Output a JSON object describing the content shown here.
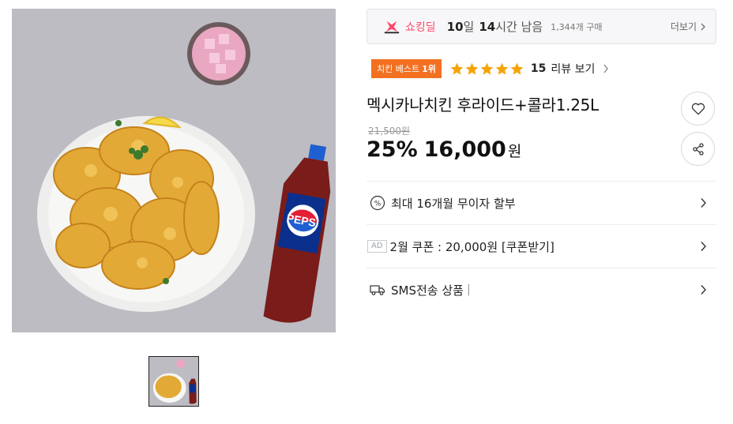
{
  "colors": {
    "deal_pink": "#ff4a6b",
    "rank_orange": "#f37021",
    "star_gold": "#f5a50a",
    "price_black": "#111111",
    "image_bg": "#bdbcc3"
  },
  "gallery": {
    "main_image_alt": "",
    "thumbnail_count": 1,
    "pepsi_label": "PEPSI"
  },
  "deal_bar": {
    "icon": "shopping-deal-icon",
    "name": "쇼킹딜",
    "days_num": "10",
    "days_unit": "일",
    "hours_num": "14",
    "hours_unit": "시간 남음",
    "purchase_count": "1,344개 구매",
    "more_label": "더보기",
    "more_icon": "chevron-right-icon"
  },
  "ranking": {
    "badge_text": "치킨 베스트",
    "badge_rank": "1위",
    "rating": 5,
    "rating_max": 5,
    "review_count": "15",
    "review_label": "리뷰 보기",
    "chevron_icon": "chevron-right-icon"
  },
  "product": {
    "title": "멕시카나치킨 후라이드+콜라1.25L",
    "original_price": "21,500원",
    "discount": "25%",
    "price": "16,000",
    "currency": "원"
  },
  "actions": {
    "like_icon": "heart-icon",
    "share_icon": "share-icon"
  },
  "info_rows": {
    "installment": {
      "icon": "percent-icon",
      "label": "최대 16개월 무이자 할부"
    },
    "coupon": {
      "badge": "AD",
      "label": "2월 쿠폰 : 20,000원 [쿠폰받기]"
    },
    "sms": {
      "icon": "delivery-truck-icon",
      "label": "SMS전송 상품",
      "separator": "|"
    }
  }
}
